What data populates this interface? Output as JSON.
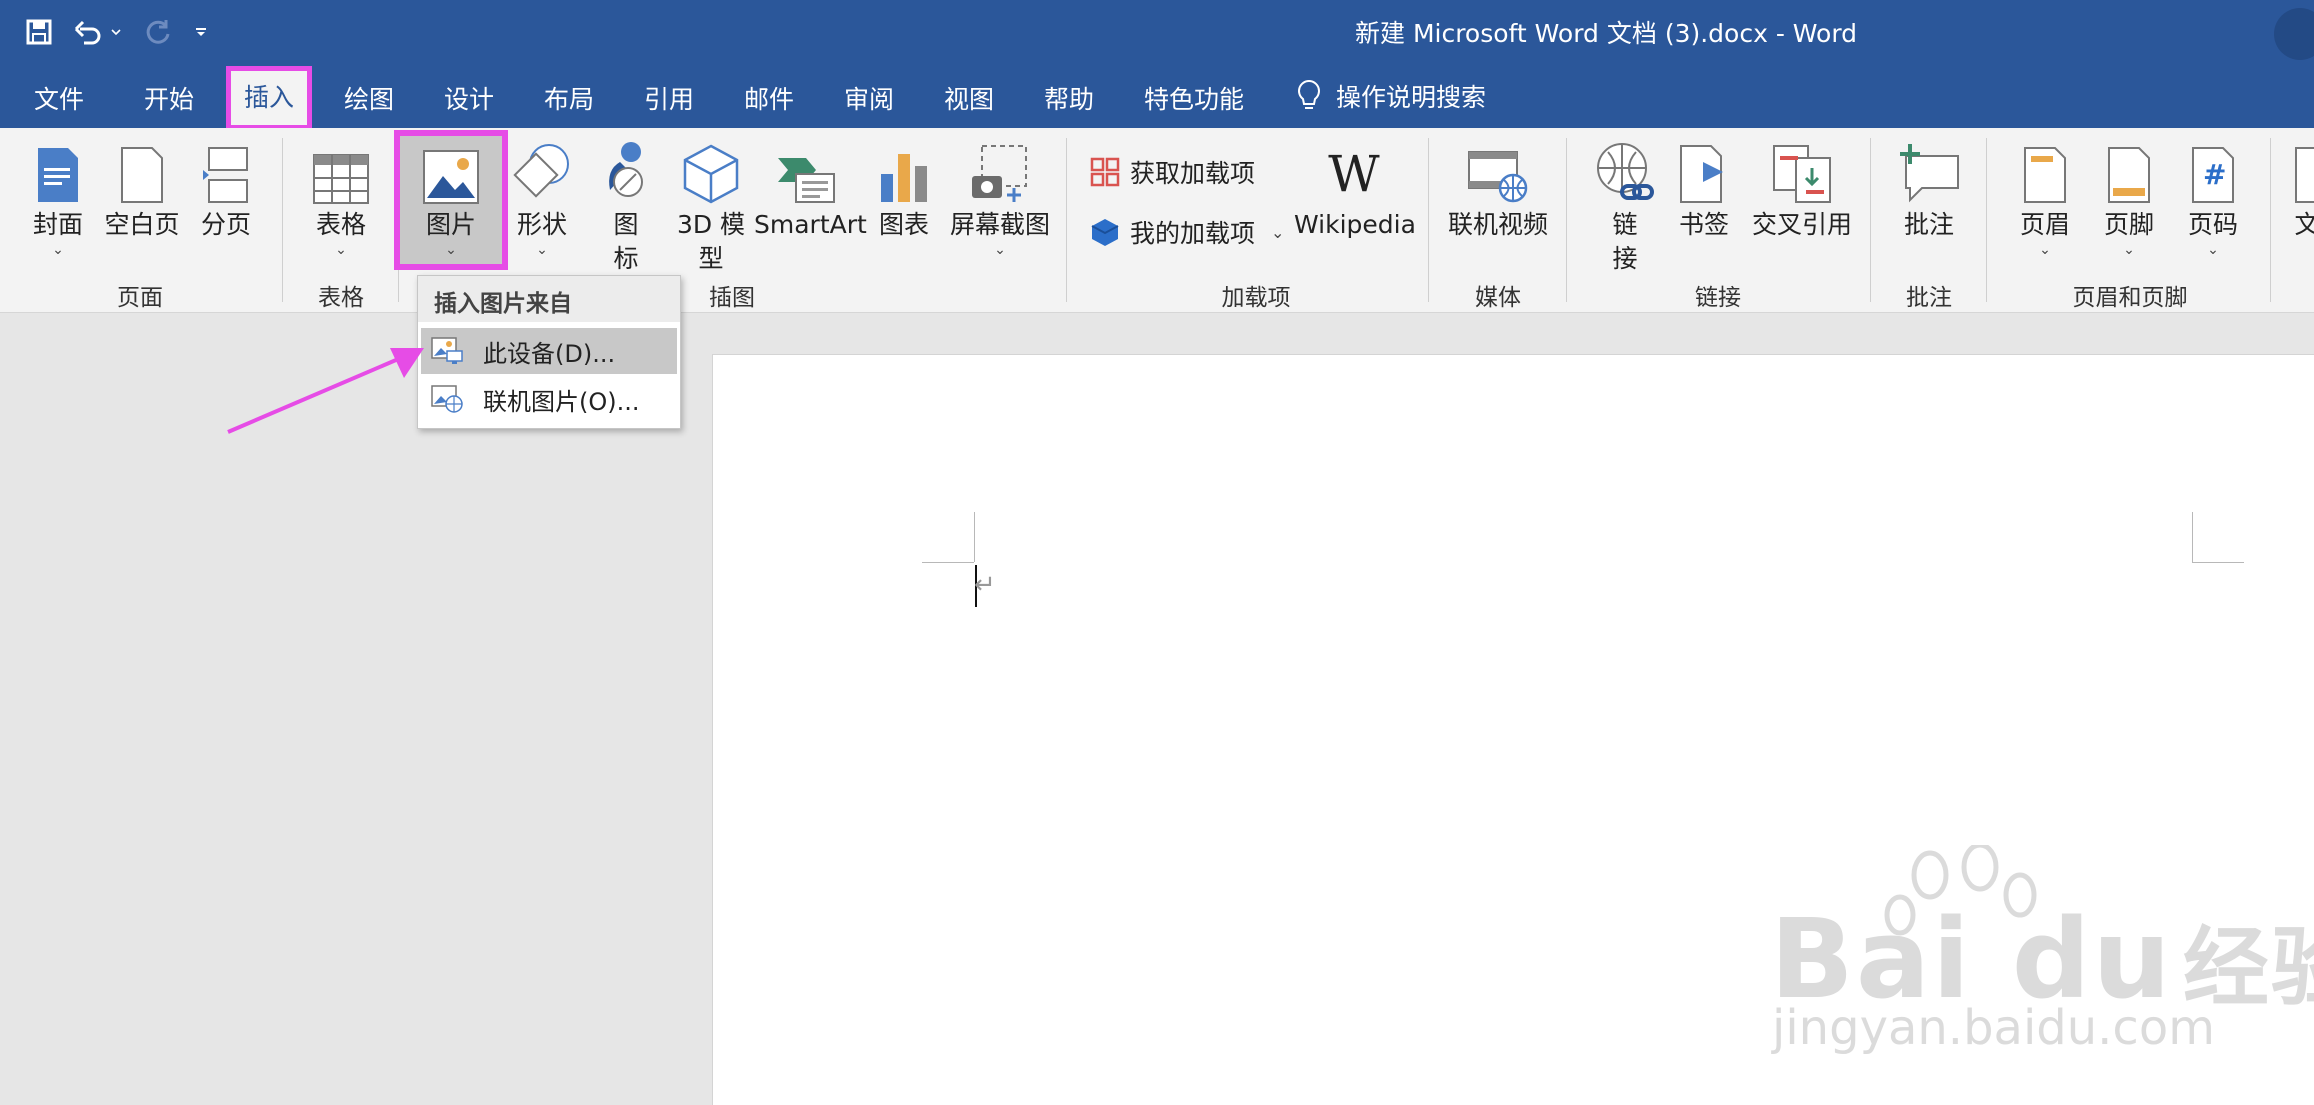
{
  "window": {
    "title": "新建 Microsoft Word 文档 (3).docx  -  Word"
  },
  "tabs": [
    "文件",
    "开始",
    "插入",
    "绘图",
    "设计",
    "布局",
    "引用",
    "邮件",
    "审阅",
    "视图",
    "帮助",
    "特色功能"
  ],
  "active_tab": "插入",
  "tell_me": "操作说明搜索",
  "ribbon": {
    "pages": {
      "cover": "封面",
      "blank": "空白页",
      "break": "分页",
      "group": "页面"
    },
    "tables": {
      "table": "表格",
      "group": "表格"
    },
    "illustrations": {
      "pictures": "图片",
      "shapes": "形状",
      "icons": [
        "图",
        "标"
      ],
      "model3d": [
        "3D 模",
        "型"
      ],
      "smartart": "SmartArt",
      "chart": "图表",
      "screenshot": "屏幕截图",
      "group": "插图"
    },
    "addins": {
      "get": "获取加载项",
      "mine": "我的加载项",
      "wikipedia": "Wikipedia",
      "wiki_glyph": "W",
      "group": "加载项"
    },
    "media": {
      "video": "联机视频",
      "group": "媒体"
    },
    "links": {
      "link": [
        "链",
        "接"
      ],
      "bookmark": "书签",
      "crossref": "交叉引用",
      "group": "链接"
    },
    "comments": {
      "comment": "批注",
      "group": "批注"
    },
    "header_footer": {
      "header": "页眉",
      "footer": "页脚",
      "page_number": "页码",
      "group": "页眉和页脚",
      "page_number_glyph": "#"
    },
    "overflow_glyph": "文",
    "chevron_glyph": "⌄"
  },
  "dropdown": {
    "header": "插入图片来自",
    "items": [
      "此设备(D)...",
      "联机图片(O)..."
    ]
  },
  "document": {
    "paragraph_mark": "↵"
  },
  "watermark": {
    "brand": "Bai",
    "du": "du",
    "product": "经验",
    "url": "jingyan.baidu.com"
  },
  "colors": {
    "title_bar": "#2b579a",
    "highlight": "#e64ce6",
    "ribbon": "#f3f3f3"
  }
}
